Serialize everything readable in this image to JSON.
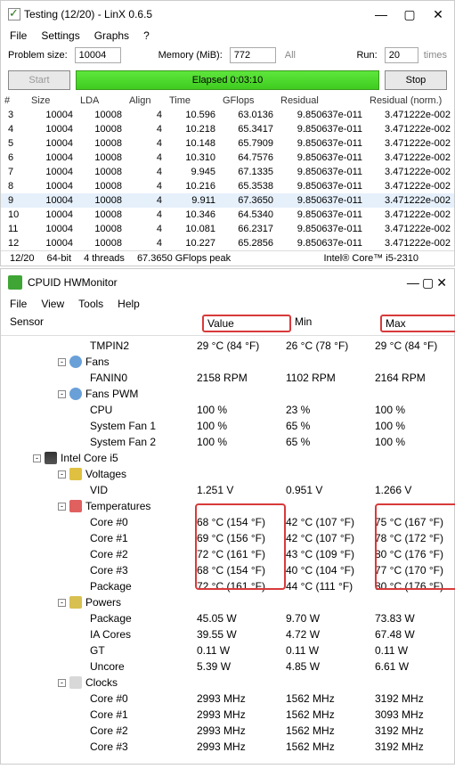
{
  "linx": {
    "title": "Testing (12/20) - LinX 0.6.5",
    "menu": [
      "File",
      "Settings",
      "Graphs",
      "?"
    ],
    "problem_label": "Problem size:",
    "problem_value": "10004",
    "memory_label": "Memory (MiB):",
    "memory_value": "772",
    "all_label": "All",
    "run_label": "Run:",
    "run_value": "20",
    "times_label": "times",
    "start": "Start",
    "stop": "Stop",
    "elapsed": "Elapsed 0:03:10",
    "cols": [
      "#",
      "Size",
      "LDA",
      "Align",
      "Time",
      "GFlops",
      "Residual",
      "Residual (norm.)"
    ],
    "rows": [
      [
        "3",
        "10004",
        "10008",
        "4",
        "10.596",
        "63.0136",
        "9.850637e-011",
        "3.471222e-002"
      ],
      [
        "4",
        "10004",
        "10008",
        "4",
        "10.218",
        "65.3417",
        "9.850637e-011",
        "3.471222e-002"
      ],
      [
        "5",
        "10004",
        "10008",
        "4",
        "10.148",
        "65.7909",
        "9.850637e-011",
        "3.471222e-002"
      ],
      [
        "6",
        "10004",
        "10008",
        "4",
        "10.310",
        "64.7576",
        "9.850637e-011",
        "3.471222e-002"
      ],
      [
        "7",
        "10004",
        "10008",
        "4",
        "9.945",
        "67.1335",
        "9.850637e-011",
        "3.471222e-002"
      ],
      [
        "8",
        "10004",
        "10008",
        "4",
        "10.216",
        "65.3538",
        "9.850637e-011",
        "3.471222e-002"
      ],
      [
        "9",
        "10004",
        "10008",
        "4",
        "9.911",
        "67.3650",
        "9.850637e-011",
        "3.471222e-002"
      ],
      [
        "10",
        "10004",
        "10008",
        "4",
        "10.346",
        "64.5340",
        "9.850637e-011",
        "3.471222e-002"
      ],
      [
        "11",
        "10004",
        "10008",
        "4",
        "10.081",
        "66.2317",
        "9.850637e-011",
        "3.471222e-002"
      ],
      [
        "12",
        "10004",
        "10008",
        "4",
        "10.227",
        "65.2856",
        "9.850637e-011",
        "3.471222e-002"
      ]
    ],
    "status": [
      "12/20",
      "64-bit",
      "4 threads",
      "67.3650 GFlops peak",
      "Intel® Core™ i5-2310"
    ]
  },
  "hw": {
    "title": "CPUID HWMonitor",
    "menu": [
      "File",
      "View",
      "Tools",
      "Help"
    ],
    "cols": {
      "sensor": "Sensor",
      "value": "Value",
      "min": "Min",
      "max": "Max"
    },
    "tmpin2": {
      "name": "TMPIN2",
      "v": "29 °C  (84 °F)",
      "min": "26 °C  (78 °F)",
      "max": "29 °C  (84 °F)"
    },
    "fans": "Fans",
    "fanin0": {
      "name": "FANIN0",
      "v": "2158 RPM",
      "min": "1102 RPM",
      "max": "2164 RPM"
    },
    "fanspwm": "Fans PWM",
    "cpu": {
      "name": "CPU",
      "v": "100 %",
      "min": "23 %",
      "max": "100 %"
    },
    "sf1": {
      "name": "System Fan 1",
      "v": "100 %",
      "min": "65 %",
      "max": "100 %"
    },
    "sf2": {
      "name": "System Fan 2",
      "v": "100 %",
      "min": "65 %",
      "max": "100 %"
    },
    "intel": "Intel Core i5",
    "voltages": "Voltages",
    "vid": {
      "name": "VID",
      "v": "1.251 V",
      "min": "0.951 V",
      "max": "1.266 V"
    },
    "temps": "Temperatures",
    "c0": {
      "name": "Core #0",
      "v": "68 °C  (154 °F)",
      "min": "42 °C  (107 °F)",
      "max": "75 °C  (167 °F)"
    },
    "c1": {
      "name": "Core #1",
      "v": "69 °C  (156 °F)",
      "min": "42 °C  (107 °F)",
      "max": "78 °C  (172 °F)"
    },
    "c2": {
      "name": "Core #2",
      "v": "72 °C  (161 °F)",
      "min": "43 °C  (109 °F)",
      "max": "80 °C  (176 °F)"
    },
    "c3": {
      "name": "Core #3",
      "v": "68 °C  (154 °F)",
      "min": "40 °C  (104 °F)",
      "max": "77 °C  (170 °F)"
    },
    "pkg": {
      "name": "Package",
      "v": "72 °C  (161 °F)",
      "min": "44 °C  (111 °F)",
      "max": "80 °C  (176 °F)"
    },
    "powers": "Powers",
    "ppkg": {
      "name": "Package",
      "v": "45.05 W",
      "min": "9.70 W",
      "max": "73.83 W"
    },
    "pia": {
      "name": "IA Cores",
      "v": "39.55 W",
      "min": "4.72 W",
      "max": "67.48 W"
    },
    "pgt": {
      "name": "GT",
      "v": "0.11 W",
      "min": "0.11 W",
      "max": "0.11 W"
    },
    "punc": {
      "name": "Uncore",
      "v": "5.39 W",
      "min": "4.85 W",
      "max": "6.61 W"
    },
    "clocks": "Clocks",
    "ck0": {
      "name": "Core #0",
      "v": "2993 MHz",
      "min": "1562 MHz",
      "max": "3192 MHz"
    },
    "ck1": {
      "name": "Core #1",
      "v": "2993 MHz",
      "min": "1562 MHz",
      "max": "3093 MHz"
    },
    "ck2": {
      "name": "Core #2",
      "v": "2993 MHz",
      "min": "1562 MHz",
      "max": "3192 MHz"
    },
    "ck3": {
      "name": "Core #3",
      "v": "2993 MHz",
      "min": "1562 MHz",
      "max": "3192 MHz"
    }
  }
}
